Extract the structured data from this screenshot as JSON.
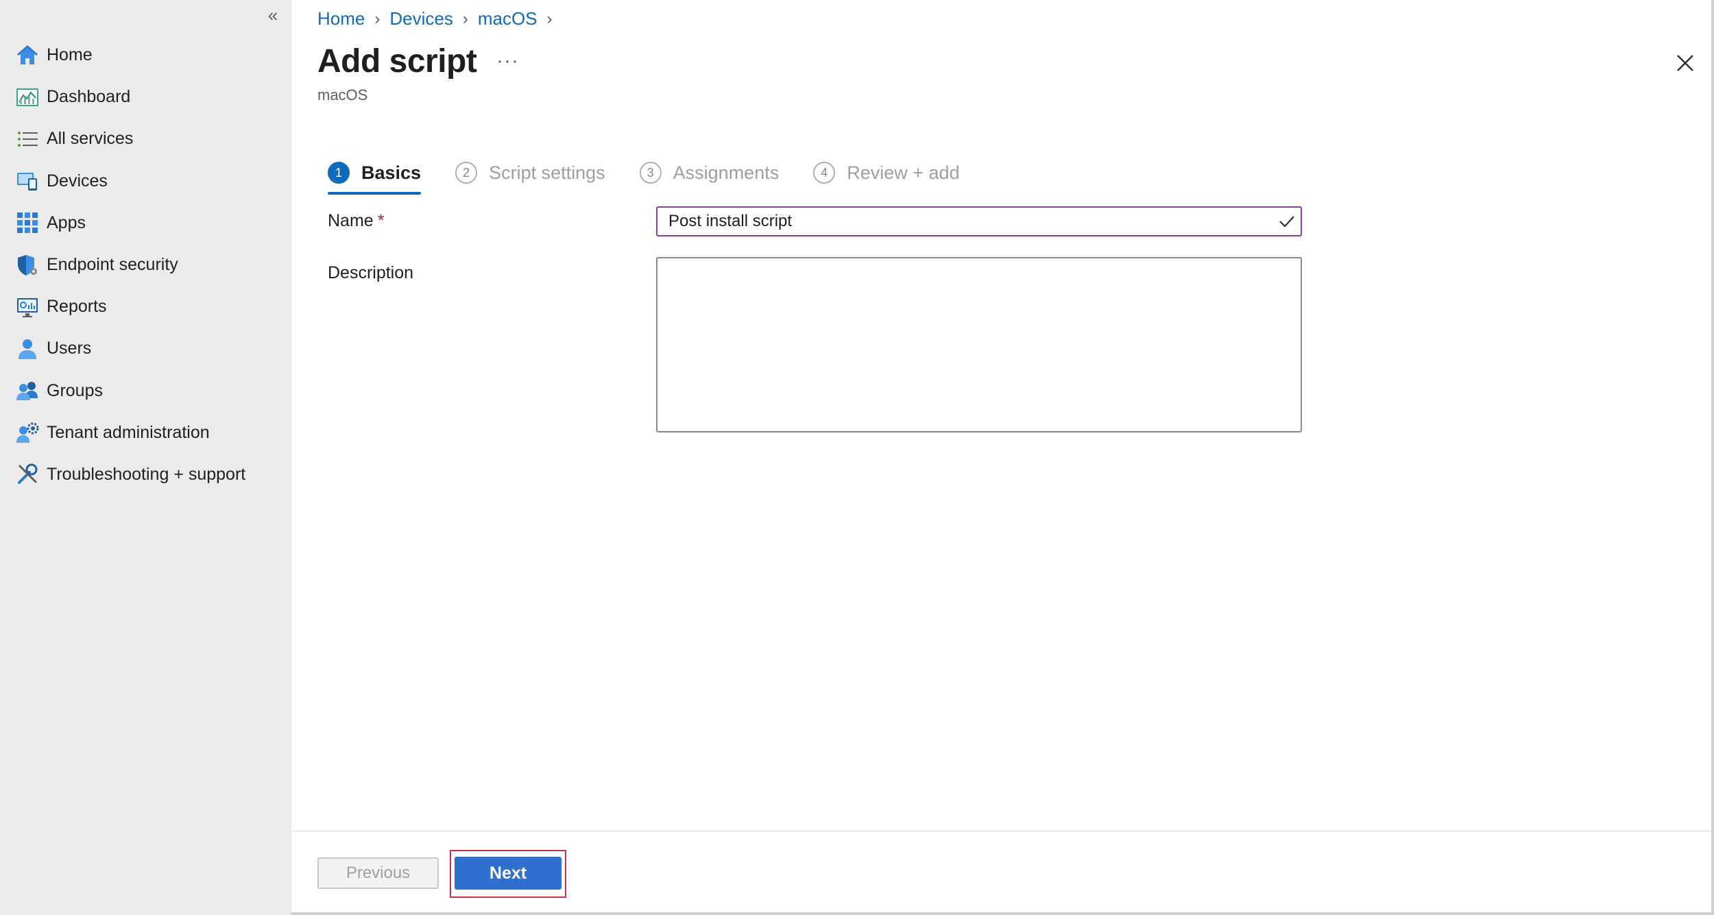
{
  "sidebar": {
    "collapse_glyph": "«",
    "items": [
      {
        "label": "Home",
        "icon": "home-icon"
      },
      {
        "label": "Dashboard",
        "icon": "dashboard-icon"
      },
      {
        "label": "All services",
        "icon": "list-icon"
      },
      {
        "label": "Devices",
        "icon": "devices-icon"
      },
      {
        "label": "Apps",
        "icon": "apps-grid-icon"
      },
      {
        "label": "Endpoint security",
        "icon": "shield-icon"
      },
      {
        "label": "Reports",
        "icon": "reports-icon"
      },
      {
        "label": "Users",
        "icon": "user-icon"
      },
      {
        "label": "Groups",
        "icon": "groups-icon"
      },
      {
        "label": "Tenant administration",
        "icon": "tenant-gear-icon"
      },
      {
        "label": "Troubleshooting + support",
        "icon": "wrench-icon"
      }
    ]
  },
  "breadcrumb": [
    "Home",
    "Devices",
    "macOS"
  ],
  "header": {
    "title": "Add script",
    "subtitle": "macOS",
    "more": "···"
  },
  "steps": [
    {
      "number": "1",
      "label": "Basics",
      "active": true
    },
    {
      "number": "2",
      "label": "Script settings",
      "active": false
    },
    {
      "number": "3",
      "label": "Assignments",
      "active": false
    },
    {
      "number": "4",
      "label": "Review + add",
      "active": false
    }
  ],
  "form": {
    "name_label": "Name",
    "required_mark": "*",
    "name_value": "Post install script",
    "description_label": "Description",
    "description_value": ""
  },
  "footer": {
    "previous_label": "Previous",
    "next_label": "Next"
  },
  "colors": {
    "accent": "#0f6cbd",
    "input_focus_border": "#8a3fb0",
    "highlight_border": "#c4314b",
    "next_button": "#2f6fd0"
  }
}
